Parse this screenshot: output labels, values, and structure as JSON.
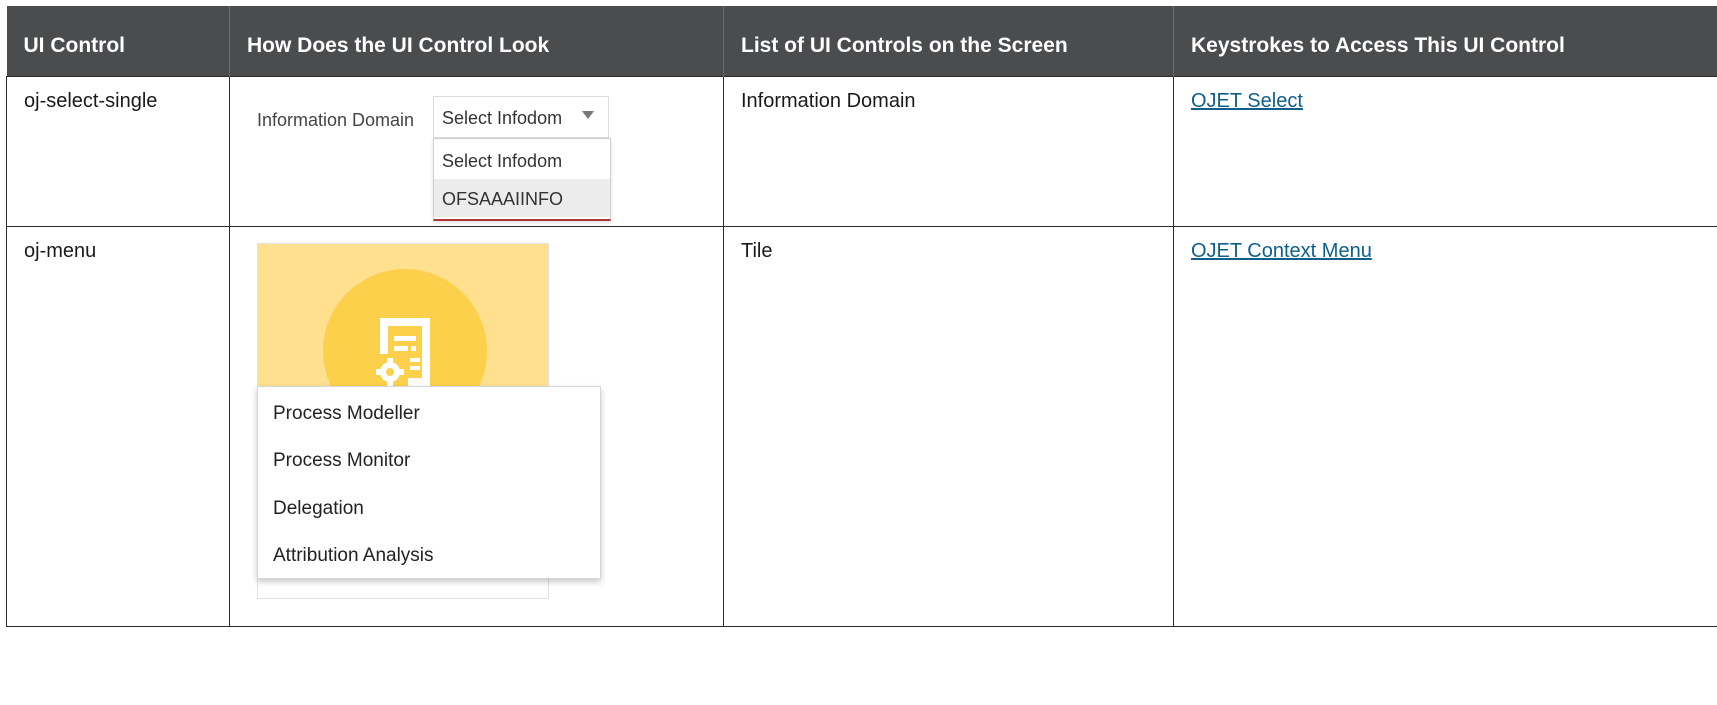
{
  "headers": [
    "UI Control",
    "How Does the UI Control Look",
    "List of UI Controls on the Screen",
    "Keystrokes to Access This UI Control"
  ],
  "rows": [
    {
      "control": "oj-select-single",
      "screen_controls": "Information Domain",
      "keystrokes_link": "OJET Select",
      "mock": {
        "label": "Information Domain",
        "selected": "Select Infodom",
        "options": [
          "Select Infodom",
          "OFSAAAIINFO"
        ]
      }
    },
    {
      "control": "oj-menu",
      "screen_controls": "Tile",
      "keystrokes_link": "OJET Context Menu",
      "mock": {
        "tile_icon": "document-gear-icon",
        "tile_color": "#fee08e",
        "circle_color": "#fcd04b",
        "menu_items": [
          "Process Modeller",
          "Process Monitor",
          "Delegation",
          "Attribution Analysis"
        ]
      }
    }
  ],
  "colors": {
    "header_bg": "#4b4c4e",
    "link": "#0f5f8a"
  }
}
